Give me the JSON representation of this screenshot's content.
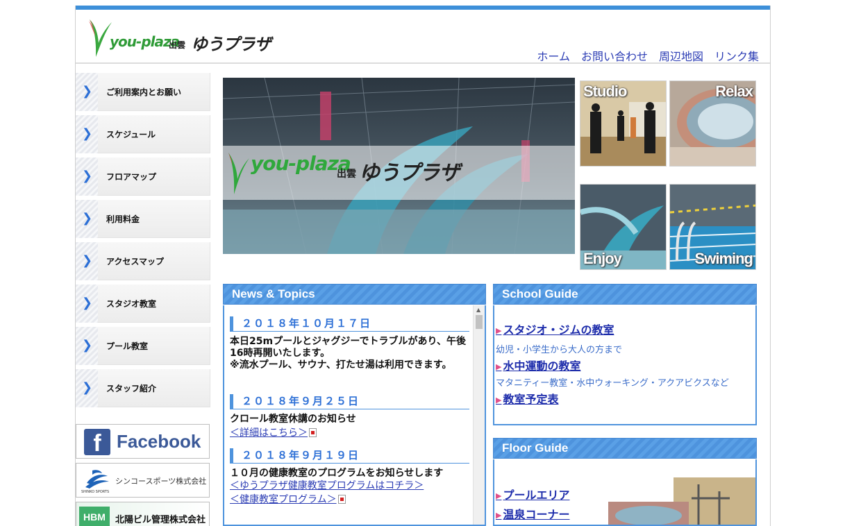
{
  "header": {
    "logo": {
      "word": "you-plaza",
      "izumo": "出雲",
      "kana": "ゆうプラザ"
    },
    "nav": [
      "ホーム",
      "お問い合わせ",
      "周辺地図",
      "リンク集"
    ]
  },
  "sidebar": {
    "items": [
      "ご利用案内とお願い",
      "スケジュール",
      "フロアマップ",
      "利用料金",
      "アクセスマップ",
      "スタジオ教室",
      "プール教室",
      "スタッフ紹介"
    ]
  },
  "banners": {
    "facebook": "Facebook",
    "shinko": {
      "name": "シンコースポーツ株式会社",
      "sub": "SHINKO SPORTS"
    },
    "hokuyo": {
      "logo": "HBM",
      "name": "北陽ビル管理株式会社"
    }
  },
  "hero": {
    "word": "you-plaza",
    "izumo": "出雲",
    "kana": "ゆうプラザ"
  },
  "thumbs": [
    "Studio",
    "Relax",
    "Enjoy",
    "Swiming"
  ],
  "news": {
    "title": "News & Topics",
    "entries": [
      {
        "date": "２０１８年１０月１７日",
        "text": "本日25mプールとジャグジーでトラブルがあり、午後16時再開いたします。\n※流水プール、サウナ、打たせ湯は利用できます。",
        "links": []
      },
      {
        "date": "２０１８年９月２５日",
        "text": "クロール教室休講のお知らせ",
        "links": [
          "＜詳細はこちら＞"
        ]
      },
      {
        "date": "２０１８年９月１９日",
        "text": "１０月の健康教室のプログラムをお知らせします",
        "links": [
          "＜ゆうプラザ健康教室プログラムはコチラ＞",
          "＜健康教室プログラム＞"
        ]
      }
    ]
  },
  "school": {
    "title": "School Guide",
    "links": [
      {
        "label": "スタジオ・ジムの教室",
        "desc": "幼児・小学生から大人の方まで"
      },
      {
        "label": "水中運動の教室",
        "desc": "マタニティー教室・水中ウォーキング・アクアビクスなど"
      },
      {
        "label": "教室予定表",
        "desc": ""
      }
    ]
  },
  "floor": {
    "title": "Floor Guide",
    "links": [
      "プールエリア",
      "温泉コーナー"
    ]
  }
}
